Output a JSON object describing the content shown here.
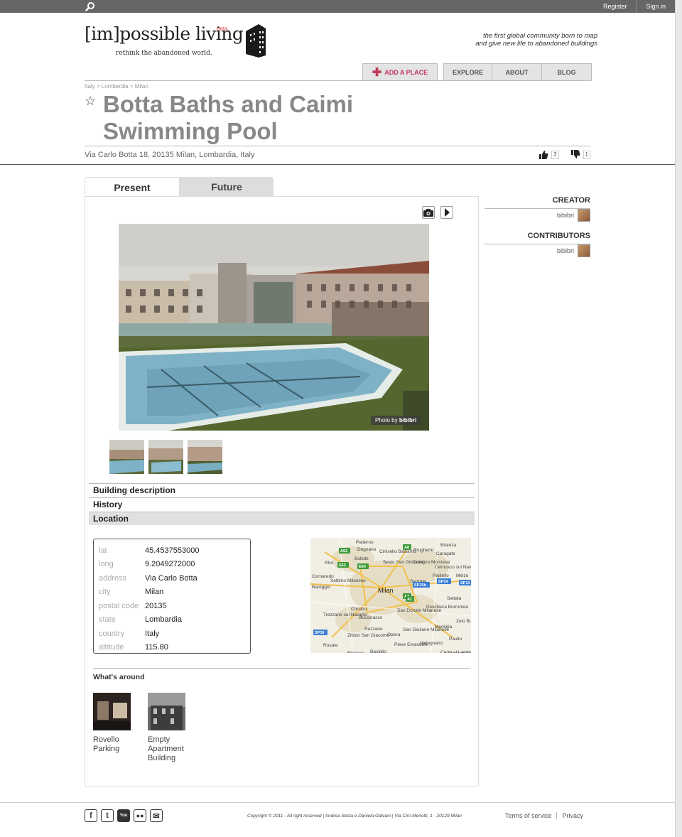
{
  "topbar": {
    "register": "Register",
    "signin": "Sign in"
  },
  "header": {
    "logo_text": "[im]possible living",
    "beta": "beta",
    "tagline": "rethink the abandoned world.",
    "mission_line1": "the first global community born to map",
    "mission_line2": "and give new life to abandoned buildings"
  },
  "nav": {
    "add_place": "ADD A PLACE",
    "explore": "EXPLORE",
    "about": "ABOUT",
    "blog": "BLOG"
  },
  "breadcrumb": "Italy > Lombardia > Milan",
  "place": {
    "title": "Botta Baths and Caimi Swimming Pool",
    "address": "Via Carlo Botta 18, 20135 Milan, Lombardia, Italy",
    "likes": "3",
    "dislikes": "1"
  },
  "tabs": {
    "present": "Present",
    "future": "Future"
  },
  "photo": {
    "credit_prefix": "Photo by",
    "credit_user": "bibibri"
  },
  "sections": {
    "description": "Building description",
    "history": "History",
    "location": "Location"
  },
  "location": {
    "rows": [
      {
        "key": "lat",
        "value": "45.4537553000"
      },
      {
        "key": "long",
        "value": "9.2049272000"
      },
      {
        "key": "address",
        "value": "Via Carlo Botta"
      },
      {
        "key": "city",
        "value": "Milan"
      },
      {
        "key": "postal code",
        "value": "20135"
      },
      {
        "key": "state",
        "value": "Lombardia"
      },
      {
        "key": "country",
        "value": "Italy"
      },
      {
        "key": "altitude",
        "value": "115.80"
      }
    ]
  },
  "map": {
    "labels": [
      "Bollate",
      "Rho",
      "Sesto San Giovanni",
      "Cologno Monzese",
      "Milan",
      "Corsico",
      "Buccinasco",
      "San Donato Milanese",
      "Peschiera Borromeo",
      "Rozzano",
      "Settimo Milanese",
      "Trezzano sul Naviglio",
      "Segrate",
      "Pioltello",
      "Melzo",
      "Brugherio",
      "Carugate",
      "Cernusco sul Naviglio",
      "Opera",
      "San Giuliano Milanese",
      "Mediglia",
      "Paullo",
      "Zelo Buon Persico",
      "Pieve Emanuele",
      "Melegnano",
      "Basiglio",
      "Binasco",
      "Rosate",
      "Zibido San Giacomo",
      "Settala",
      "Cinisello Balsamo",
      "Dugnano",
      "Paderno",
      "Brianza",
      "Cerro al Lambro",
      "Tavazzano",
      "Bareggio",
      "Cornaredo"
    ],
    "badges": [
      "A52",
      "A8",
      "E62",
      "E64",
      "A4",
      "SP15b",
      "SP14",
      "SP13",
      "A1",
      "SP30"
    ]
  },
  "around": {
    "title": "What's around",
    "items": [
      {
        "label": "Rovello Parking"
      },
      {
        "label": "Empty Apartment Building"
      }
    ]
  },
  "sidebar": {
    "creator_title": "CREATOR",
    "creator": "bibibri",
    "contributors_title": "CONTRIBUTORS",
    "contributor": "bibibri"
  },
  "footer": {
    "socials": [
      "facebook-icon",
      "twitter-icon",
      "youtube-icon",
      "flickr-icon",
      "mail-icon"
    ],
    "copyright": "Copyright © 2011 - All right reserved | Andrea Sesta e Daniela Galvani | Via Ciro Menotti, 1 - 20129 Milan",
    "terms": "Terms of service",
    "privacy": "Privacy"
  }
}
